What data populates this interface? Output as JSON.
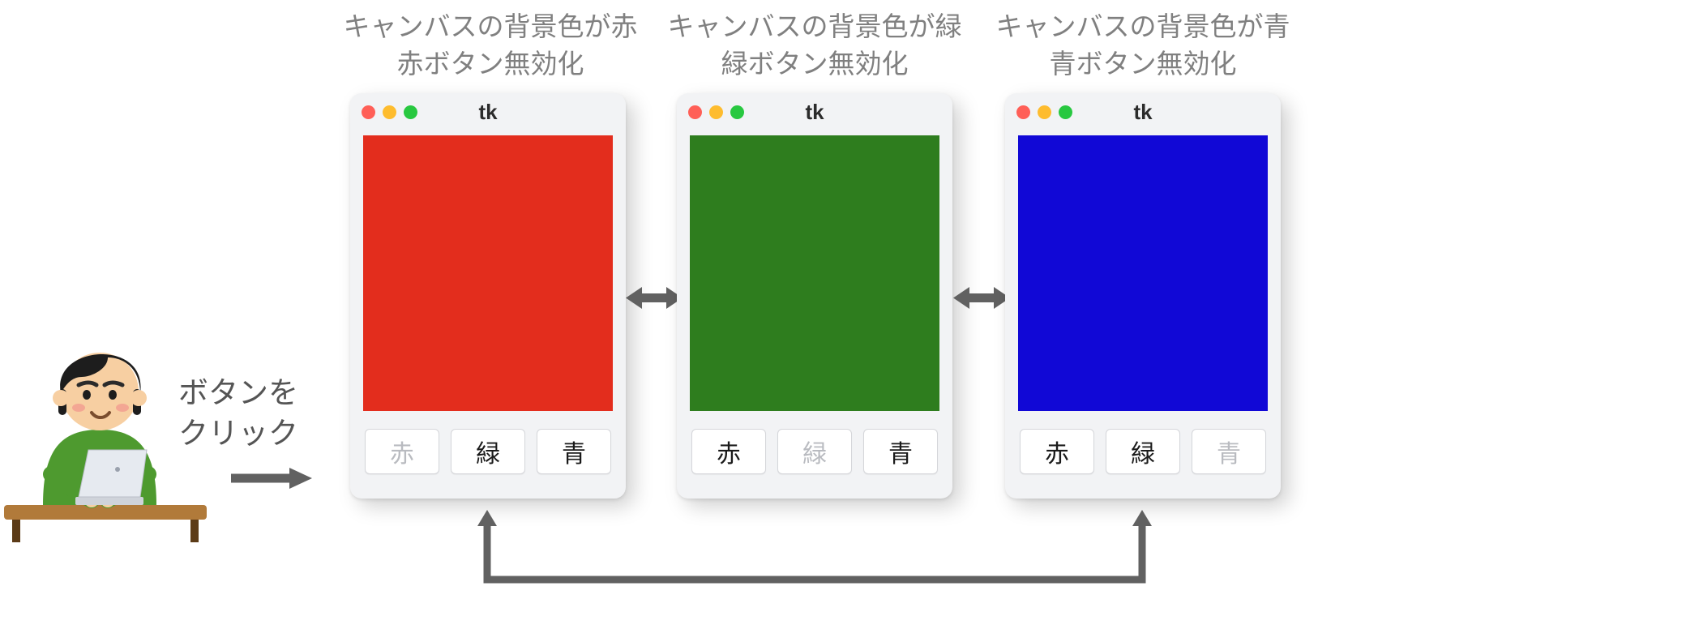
{
  "user_action": {
    "line1": "ボタンを",
    "line2": "クリック"
  },
  "captions": {
    "red": {
      "line1": "キャンバスの背景色が赤",
      "line2": "赤ボタン無効化"
    },
    "green": {
      "line1": "キャンバスの背景色が緑",
      "line2": "緑ボタン無効化"
    },
    "blue": {
      "line1": "キャンバスの背景色が青",
      "line2": "青ボタン無効化"
    }
  },
  "window_title": "tk",
  "buttons": {
    "red": "赤",
    "green": "緑",
    "blue": "青"
  },
  "canvas_colors": {
    "red": "#e32d1d",
    "green": "#2e7d1e",
    "blue": "#1108d6"
  },
  "traffic_light_colors": {
    "close": "#ff5f57",
    "minimize": "#febc2e",
    "maximize": "#28c840"
  },
  "arrow_color": "#616161",
  "caption_text_color": "#808080"
}
